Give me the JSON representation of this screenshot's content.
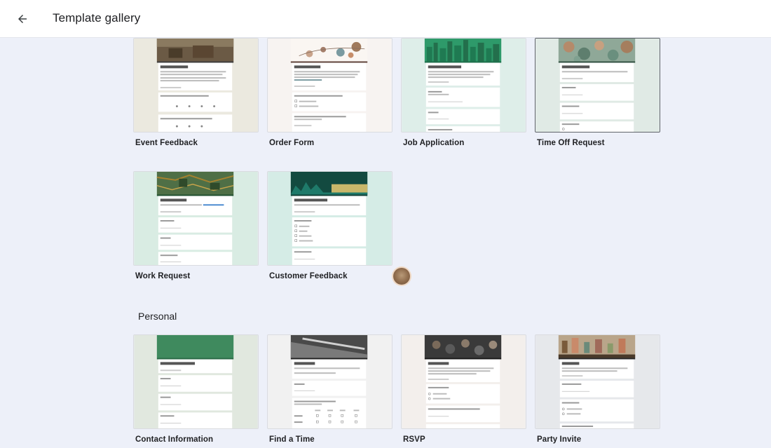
{
  "header": {
    "title": "Template gallery"
  },
  "sections": {
    "personal_heading": "Personal"
  },
  "templates": {
    "work": [
      {
        "label": "Event Feedback",
        "theme": "#4a4030"
      },
      {
        "label": "Order Form",
        "theme": "#6d4c41"
      },
      {
        "label": "Job Application",
        "theme": "#1e8e5a"
      },
      {
        "label": "Time Off Request",
        "theme": "#4a6b55"
      },
      {
        "label": "Work Request",
        "theme": "#3d6b3a"
      },
      {
        "label": "Customer Feedback",
        "theme": "#1e6b5e"
      }
    ],
    "personal": [
      {
        "label": "Contact Information",
        "theme": "#3b7a57"
      },
      {
        "label": "Find a Time",
        "theme": "#606060"
      },
      {
        "label": "RSVP",
        "theme": "#3a3a3a"
      },
      {
        "label": "Party Invite",
        "theme": "#8a6a4a"
      }
    ]
  },
  "colors": {
    "background": "#edf0f9",
    "topbar": "#ffffff",
    "card_border": "#dadce0"
  }
}
